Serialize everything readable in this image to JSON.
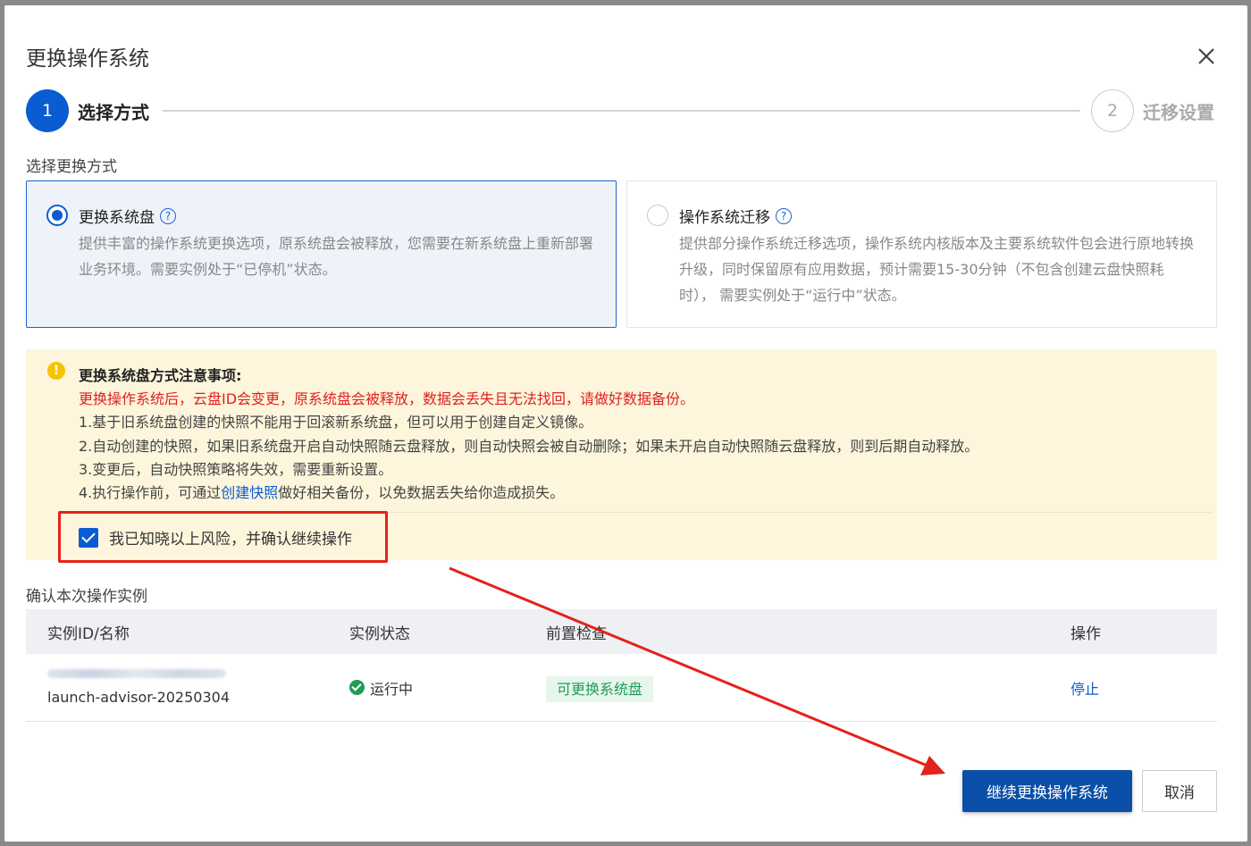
{
  "dialog": {
    "title": "更换操作系统",
    "close_icon": "close-icon"
  },
  "steps": [
    {
      "number": "1",
      "label": "选择方式",
      "active": true
    },
    {
      "number": "2",
      "label": "迁移设置",
      "active": false
    }
  ],
  "method": {
    "section_label": "选择更换方式",
    "options": [
      {
        "title": "更换系统盘",
        "help_icon": "question-icon",
        "selected": true,
        "desc": "提供丰富的操作系统更换选项，原系统盘会被释放，您需要在新系统盘上重新部署业务环境。需要实例处于“已停机”状态。"
      },
      {
        "title": "操作系统迁移",
        "help_icon": "question-icon",
        "selected": false,
        "desc": "提供部分操作系统迁移选项，操作系统内核版本及主要系统软件包会进行原地转换升级，同时保留原有应用数据，预计需要15-30分钟（不包含创建云盘快照耗时）， 需要实例处于“运行中”状态。"
      }
    ]
  },
  "notice": {
    "icon": "warning-icon",
    "title": "更换系统盘方式注意事项:",
    "warning": "更换操作系统后，云盘ID会变更，原系统盘会被释放，数据会丢失且无法找回，请做好数据备份。",
    "items": [
      "1.基于旧系统盘创建的快照不能用于回滚新系统盘，但可以用于创建自定义镜像。",
      "2.自动创建的快照，如果旧系统盘开启自动快照随云盘释放，则自动快照会被自动删除；如果未开启自动快照随云盘释放，则到后期自动释放。",
      "3.变更后，自动快照策略将失效，需要重新设置。"
    ],
    "item4_prefix": "4.执行操作前，可通过",
    "item4_link": "创建快照",
    "item4_suffix": "做好相关备份，以免数据丢失给你造成损失。",
    "confirm_label": "我已知晓以上风险，并确认继续操作",
    "confirm_checked": true
  },
  "instances": {
    "section_label": "确认本次操作实例",
    "columns": [
      "实例ID/名称",
      "实例状态",
      "前置检查",
      "操作"
    ],
    "rows": [
      {
        "name": "launch-advisor-20250304",
        "status": "运行中",
        "check": "可更换系统盘",
        "action": "停止"
      }
    ]
  },
  "footer": {
    "primary": "继续更换操作系统",
    "cancel": "取消"
  },
  "colors": {
    "primary": "#0a5cd1",
    "warning_text": "#e02020",
    "notice_bg": "#fdf6dc",
    "success": "#1f9d55",
    "annotation": "#e4221b"
  }
}
